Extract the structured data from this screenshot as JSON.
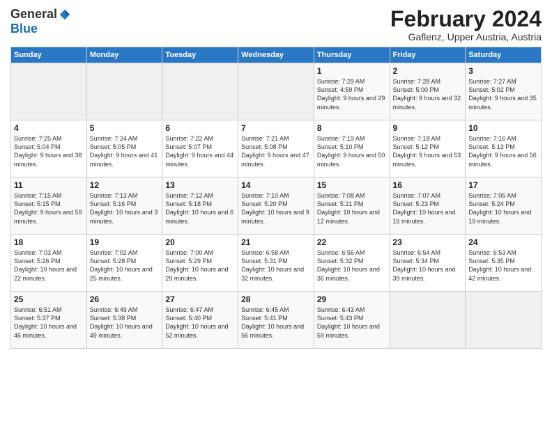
{
  "logo": {
    "general": "General",
    "blue": "Blue"
  },
  "header": {
    "title": "February 2024",
    "subtitle": "Gaflenz, Upper Austria, Austria"
  },
  "weekdays": [
    "Sunday",
    "Monday",
    "Tuesday",
    "Wednesday",
    "Thursday",
    "Friday",
    "Saturday"
  ],
  "weeks": [
    [
      {
        "day": "",
        "info": ""
      },
      {
        "day": "",
        "info": ""
      },
      {
        "day": "",
        "info": ""
      },
      {
        "day": "",
        "info": ""
      },
      {
        "day": "1",
        "info": "Sunrise: 7:29 AM\nSunset: 4:59 PM\nDaylight: 9 hours\nand 29 minutes."
      },
      {
        "day": "2",
        "info": "Sunrise: 7:28 AM\nSunset: 5:00 PM\nDaylight: 9 hours\nand 32 minutes."
      },
      {
        "day": "3",
        "info": "Sunrise: 7:27 AM\nSunset: 5:02 PM\nDaylight: 9 hours\nand 35 minutes."
      }
    ],
    [
      {
        "day": "4",
        "info": "Sunrise: 7:25 AM\nSunset: 5:04 PM\nDaylight: 9 hours\nand 38 minutes."
      },
      {
        "day": "5",
        "info": "Sunrise: 7:24 AM\nSunset: 5:05 PM\nDaylight: 9 hours\nand 41 minutes."
      },
      {
        "day": "6",
        "info": "Sunrise: 7:22 AM\nSunset: 5:07 PM\nDaylight: 9 hours\nand 44 minutes."
      },
      {
        "day": "7",
        "info": "Sunrise: 7:21 AM\nSunset: 5:08 PM\nDaylight: 9 hours\nand 47 minutes."
      },
      {
        "day": "8",
        "info": "Sunrise: 7:19 AM\nSunset: 5:10 PM\nDaylight: 9 hours\nand 50 minutes."
      },
      {
        "day": "9",
        "info": "Sunrise: 7:18 AM\nSunset: 5:12 PM\nDaylight: 9 hours\nand 53 minutes."
      },
      {
        "day": "10",
        "info": "Sunrise: 7:16 AM\nSunset: 5:13 PM\nDaylight: 9 hours\nand 56 minutes."
      }
    ],
    [
      {
        "day": "11",
        "info": "Sunrise: 7:15 AM\nSunset: 5:15 PM\nDaylight: 9 hours\nand 59 minutes."
      },
      {
        "day": "12",
        "info": "Sunrise: 7:13 AM\nSunset: 5:16 PM\nDaylight: 10 hours\nand 3 minutes."
      },
      {
        "day": "13",
        "info": "Sunrise: 7:12 AM\nSunset: 5:18 PM\nDaylight: 10 hours\nand 6 minutes."
      },
      {
        "day": "14",
        "info": "Sunrise: 7:10 AM\nSunset: 5:20 PM\nDaylight: 10 hours\nand 9 minutes."
      },
      {
        "day": "15",
        "info": "Sunrise: 7:08 AM\nSunset: 5:21 PM\nDaylight: 10 hours\nand 12 minutes."
      },
      {
        "day": "16",
        "info": "Sunrise: 7:07 AM\nSunset: 5:23 PM\nDaylight: 10 hours\nand 16 minutes."
      },
      {
        "day": "17",
        "info": "Sunrise: 7:05 AM\nSunset: 5:24 PM\nDaylight: 10 hours\nand 19 minutes."
      }
    ],
    [
      {
        "day": "18",
        "info": "Sunrise: 7:03 AM\nSunset: 5:26 PM\nDaylight: 10 hours\nand 22 minutes."
      },
      {
        "day": "19",
        "info": "Sunrise: 7:02 AM\nSunset: 5:28 PM\nDaylight: 10 hours\nand 25 minutes."
      },
      {
        "day": "20",
        "info": "Sunrise: 7:00 AM\nSunset: 5:29 PM\nDaylight: 10 hours\nand 29 minutes."
      },
      {
        "day": "21",
        "info": "Sunrise: 6:58 AM\nSunset: 5:31 PM\nDaylight: 10 hours\nand 32 minutes."
      },
      {
        "day": "22",
        "info": "Sunrise: 6:56 AM\nSunset: 5:32 PM\nDaylight: 10 hours\nand 36 minutes."
      },
      {
        "day": "23",
        "info": "Sunrise: 6:54 AM\nSunset: 5:34 PM\nDaylight: 10 hours\nand 39 minutes."
      },
      {
        "day": "24",
        "info": "Sunrise: 6:53 AM\nSunset: 5:35 PM\nDaylight: 10 hours\nand 42 minutes."
      }
    ],
    [
      {
        "day": "25",
        "info": "Sunrise: 6:51 AM\nSunset: 5:37 PM\nDaylight: 10 hours\nand 46 minutes."
      },
      {
        "day": "26",
        "info": "Sunrise: 6:49 AM\nSunset: 5:38 PM\nDaylight: 10 hours\nand 49 minutes."
      },
      {
        "day": "27",
        "info": "Sunrise: 6:47 AM\nSunset: 5:40 PM\nDaylight: 10 hours\nand 52 minutes."
      },
      {
        "day": "28",
        "info": "Sunrise: 6:45 AM\nSunset: 5:41 PM\nDaylight: 10 hours\nand 56 minutes."
      },
      {
        "day": "29",
        "info": "Sunrise: 6:43 AM\nSunset: 5:43 PM\nDaylight: 10 hours\nand 59 minutes."
      },
      {
        "day": "",
        "info": ""
      },
      {
        "day": "",
        "info": ""
      }
    ]
  ]
}
